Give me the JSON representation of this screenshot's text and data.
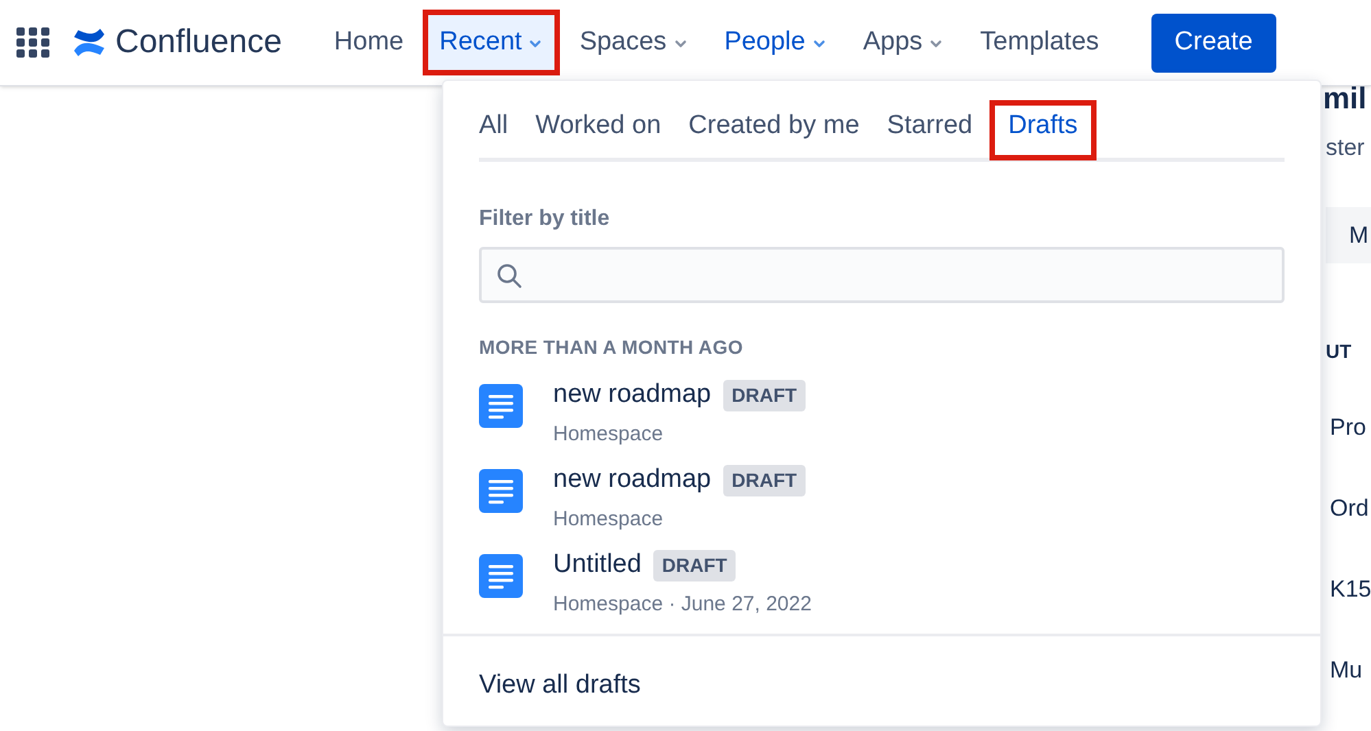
{
  "header": {
    "product": "Confluence",
    "nav": [
      {
        "label": "Home",
        "dropdown": false,
        "selected": false,
        "emphasized": false,
        "highlighted": false
      },
      {
        "label": "Recent",
        "dropdown": true,
        "selected": true,
        "emphasized": true,
        "highlighted": true
      },
      {
        "label": "Spaces",
        "dropdown": true,
        "selected": false,
        "emphasized": false,
        "highlighted": false
      },
      {
        "label": "People",
        "dropdown": true,
        "selected": false,
        "emphasized": true,
        "highlighted": false
      },
      {
        "label": "Apps",
        "dropdown": true,
        "selected": false,
        "emphasized": false,
        "highlighted": false
      },
      {
        "label": "Templates",
        "dropdown": false,
        "selected": false,
        "emphasized": false,
        "highlighted": false
      }
    ],
    "create_button": "Create"
  },
  "background_page": {
    "heading": "mil",
    "subtitle": "ster",
    "button": "M",
    "section": "UT",
    "items": [
      "Pro",
      "Ord",
      "K15",
      "Mu"
    ]
  },
  "dropdown": {
    "tabs": [
      {
        "label": "All",
        "selected": false,
        "highlighted": false
      },
      {
        "label": "Worked on",
        "selected": false,
        "highlighted": false
      },
      {
        "label": "Created by me",
        "selected": false,
        "highlighted": false
      },
      {
        "label": "Starred",
        "selected": false,
        "highlighted": false
      },
      {
        "label": "Drafts",
        "selected": true,
        "highlighted": true
      }
    ],
    "filter": {
      "label": "Filter by title"
    },
    "section": "MORE THAN A MONTH AGO",
    "items": [
      {
        "title": "new roadmap",
        "badge": "DRAFT",
        "meta": "Homespace"
      },
      {
        "title": "new roadmap",
        "badge": "DRAFT",
        "meta": "Homespace"
      },
      {
        "title": "Untitled",
        "badge": "DRAFT",
        "meta": "Homespace · June 27, 2022"
      }
    ],
    "footer_link": "View all drafts"
  }
}
